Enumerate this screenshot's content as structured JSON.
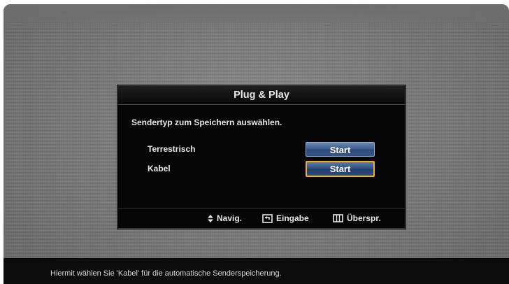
{
  "dialog": {
    "title": "Plug & Play",
    "prompt": "Sendertyp zum Speichern auswählen.",
    "options": [
      {
        "label": "Terrestrisch",
        "button": "Start",
        "selected": false
      },
      {
        "label": "Kabel",
        "button": "Start",
        "selected": true
      }
    ],
    "footer": {
      "nav_label": "Navig.",
      "enter_label": "Eingabe",
      "skip_label": "Überspr."
    }
  },
  "status_bar": {
    "text": "Hiermit wählen Sie 'Kabel' für die automatische Senderspeicherung."
  },
  "colors": {
    "button_blue": "#3e5c8c",
    "focus_border": "#f0b020",
    "dialog_bg": "#060606"
  }
}
